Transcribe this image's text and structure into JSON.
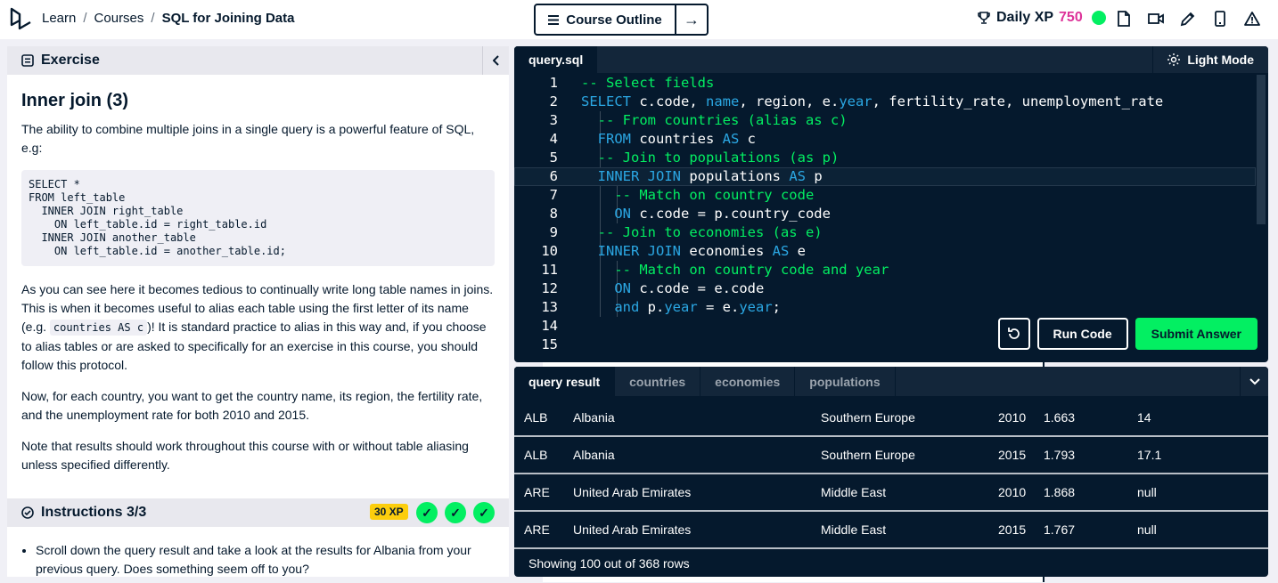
{
  "breadcrumb": {
    "learn": "Learn",
    "courses": "Courses",
    "current": "SQL for Joining Data",
    "sep": "/"
  },
  "nav": {
    "prev_icon": "←",
    "outline_label": "Course Outline",
    "next_icon": "→"
  },
  "xp": {
    "label": "Daily XP",
    "value": "750"
  },
  "exercise": {
    "header": "Exercise",
    "title": "Inner join (3)",
    "intro": "The ability to combine multiple joins in a single query is a powerful feature of SQL, e.g:",
    "code": "SELECT *\nFROM left_table\n  INNER JOIN right_table\n    ON left_table.id = right_table.id\n  INNER JOIN another_table\n    ON left_table.id = another_table.id;",
    "p2_before": "As you can see here it becomes tedious to continually write long table names in joins. This is when it becomes useful to alias each table using the first letter of its name (e.g. ",
    "p2_code": "countries AS c",
    "p2_after": ")! It is standard practice to alias in this way and, if you choose to alias tables or are asked to specifically for an exercise in this course, you should follow this protocol.",
    "p3": "Now, for each country, you want to get the country name, its region, the fertility rate, and the unemployment rate for both 2010 and 2015.",
    "p4": "Note that results should work throughout this course with or without table aliasing unless specified differently."
  },
  "instructions": {
    "header": "Instructions 3/3",
    "xp_badge": "30 XP",
    "items": [
      "Scroll down the query result and take a look at the results for Albania from your previous query. Does something seem off to you?"
    ]
  },
  "editor": {
    "tab": "query.sql",
    "light_mode": "Light Mode",
    "line_numbers": [
      "1",
      "2",
      "3",
      "4",
      "5",
      "6",
      "7",
      "8",
      "9",
      "10",
      "11",
      "12",
      "13",
      "14",
      "15"
    ],
    "lines": {
      "l1": "-- Select fields",
      "l2_kw": "SELECT",
      "l2_a": " c.code, ",
      "l2_kw2": "name",
      "l2_b": ", region, e.",
      "l2_kw3": "year",
      "l2_c": ", fertility_rate, unemployment_rate",
      "l3": "-- From countries (alias as c)",
      "l4_kw": "FROM",
      "l4_a": " countries ",
      "l4_kw2": "AS",
      "l4_b": " c",
      "l5": "-- Join to populations (as p)",
      "l6_kw": "INNER JOIN",
      "l6_a": " populations ",
      "l6_kw2": "AS",
      "l6_b": " p",
      "l7": "-- Match on country code",
      "l8_kw": "ON",
      "l8_a": " c.code = p.country_code",
      "l9": "-- Join to economies (as e)",
      "l10_kw": "INNER JOIN",
      "l10_a": " economies ",
      "l10_kw2": "AS",
      "l10_b": " e",
      "l11": "-- Match on country code and year",
      "l12_kw": "ON",
      "l12_a": " c.code = e.code",
      "l13_kw": "and",
      "l13_a": " p.",
      "l13_kw2": "year",
      "l13_b": " = e.",
      "l13_kw3": "year",
      "l13_c": ";"
    },
    "run_label": "Run Code",
    "submit_label": "Submit Answer"
  },
  "results": {
    "tabs": [
      "query result",
      "countries",
      "economies",
      "populations"
    ],
    "rows": [
      [
        "ALB",
        "Albania",
        "Southern Europe",
        "2010",
        "1.663",
        "14"
      ],
      [
        "ALB",
        "Albania",
        "Southern Europe",
        "2015",
        "1.793",
        "17.1"
      ],
      [
        "ARE",
        "United Arab Emirates",
        "Middle East",
        "2010",
        "1.868",
        "null"
      ],
      [
        "ARE",
        "United Arab Emirates",
        "Middle East",
        "2015",
        "1.767",
        "null"
      ]
    ],
    "status": "Showing 100 out of 368 rows"
  },
  "colors": {
    "accent_green": "#03ef62",
    "navy": "#05192d",
    "xp_pink": "#dd3399",
    "keyword_blue": "#2ba7e3"
  }
}
